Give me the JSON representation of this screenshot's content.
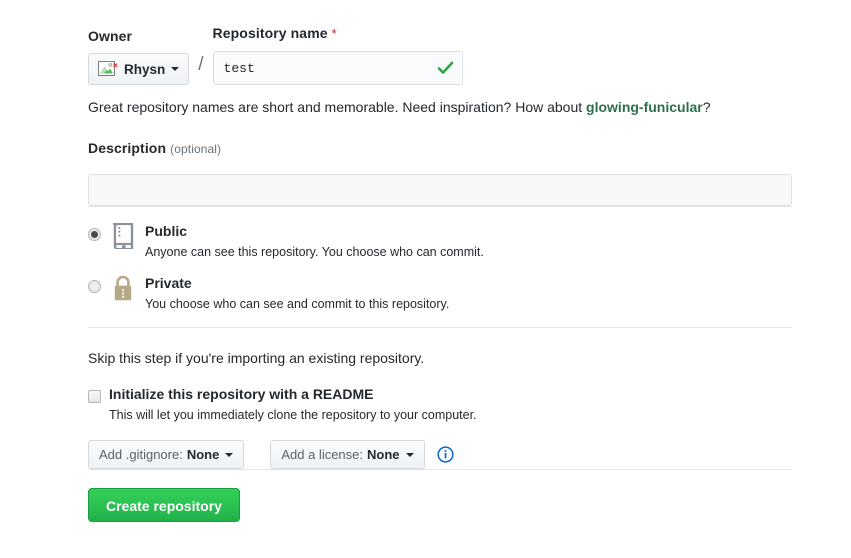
{
  "owner": {
    "label": "Owner",
    "name": "Rhysn",
    "avatar_icon": "broken-image-icon"
  },
  "separator": "/",
  "repo_name": {
    "label": "Repository name",
    "required_mark": "*",
    "value": "test",
    "placeholder": "",
    "valid_icon": "check-icon"
  },
  "hint": {
    "text_before": "Great repository names are short and memorable. Need inspiration? How about ",
    "suggestion": "glowing-funicular",
    "text_after": "?"
  },
  "description": {
    "label": "Description",
    "optional": "(optional)",
    "value": "",
    "placeholder": ""
  },
  "visibility": {
    "options": [
      {
        "title": "Public",
        "description": "Anyone can see this repository. You choose who can commit.",
        "icon": "repo-icon",
        "selected": true
      },
      {
        "title": "Private",
        "description": "You choose who can see and commit to this repository.",
        "icon": "lock-icon",
        "selected": false
      }
    ]
  },
  "initialize": {
    "skip_text": "Skip this step if you're importing an existing repository.",
    "readme_label": "Initialize this repository with a README",
    "readme_description": "This will let you immediately clone the repository to your computer.",
    "readme_checked": false,
    "gitignore": {
      "prefix": "Add .gitignore:",
      "value": "None"
    },
    "license": {
      "prefix": "Add a license:",
      "value": "None"
    },
    "info_icon": "info-icon"
  },
  "submit": {
    "label": "Create repository"
  },
  "colors": {
    "accent_green": "#2cbe4e",
    "link_green": "#2f6f4e",
    "required_red": "#cb2431",
    "lock_tan": "#b5a987",
    "repo_gray": "#8a9199",
    "info_blue": "#0366d6",
    "border": "#e5e5e5"
  }
}
